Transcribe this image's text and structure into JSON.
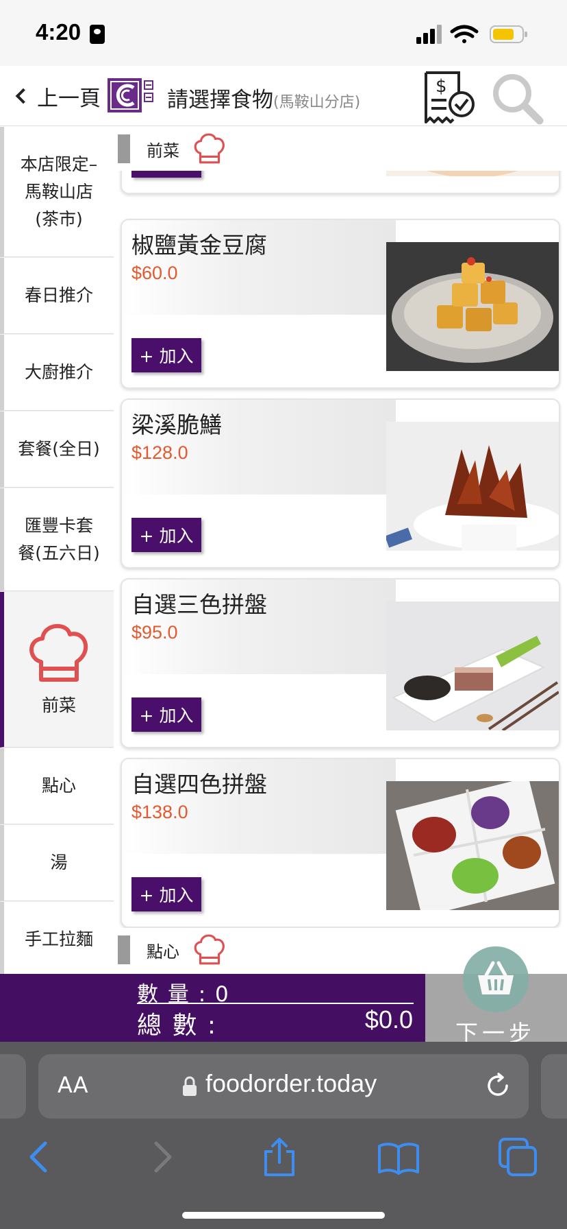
{
  "status_bar": {
    "time": "4:20"
  },
  "header": {
    "back_label": "上一頁",
    "title": "請選擇食物",
    "branch": "(馬鞍山分店)"
  },
  "sidebar": {
    "items": [
      {
        "label": "本店限定–\n馬鞍山店\n(茶市)"
      },
      {
        "label": "春日推介"
      },
      {
        "label": "大廚推介"
      },
      {
        "label": "套餐(全日)"
      },
      {
        "label": "匯豐卡套\n餐(五六日)"
      },
      {
        "label": "前菜"
      },
      {
        "label": "點心"
      },
      {
        "label": "湯"
      },
      {
        "label": "手工拉麵"
      }
    ]
  },
  "sections": {
    "appetizer": {
      "title": "前菜",
      "partial_add_label": "+ 加入"
    },
    "dimsum": {
      "title": "點心"
    }
  },
  "menu_items": [
    {
      "name": "椒鹽黃金豆腐",
      "price": "$60.0",
      "add_label": "+ 加入"
    },
    {
      "name": "梁溪脆鱔",
      "price": "$128.0",
      "add_label": "+ 加入"
    },
    {
      "name": "自選三色拼盤",
      "price": "$95.0",
      "add_label": "+ 加入"
    },
    {
      "name": "自選四色拼盤",
      "price": "$138.0",
      "add_label": "+ 加入"
    }
  ],
  "cart": {
    "quantity_label": "數 量 :",
    "quantity": "0",
    "total_label": "總 數 :",
    "total": "$0.0",
    "next_label": "下一步"
  },
  "browser": {
    "text_size_label": "AA",
    "url": "foodorder.today"
  },
  "colors": {
    "brand_purple": "#4a0f6b",
    "price_orange": "#e4592e",
    "chef_red": "#e05050",
    "basket_teal": "#84aea7"
  },
  "icons": {
    "header": [
      "back-chevron-icon",
      "logo",
      "receipt-icon",
      "search-icon"
    ],
    "category": "chef-hat-icon",
    "cart": "basket-icon",
    "browser": [
      "lock-icon",
      "reload-icon",
      "back-icon",
      "forward-icon",
      "share-icon",
      "bookmarks-icon",
      "tabs-icon"
    ]
  }
}
